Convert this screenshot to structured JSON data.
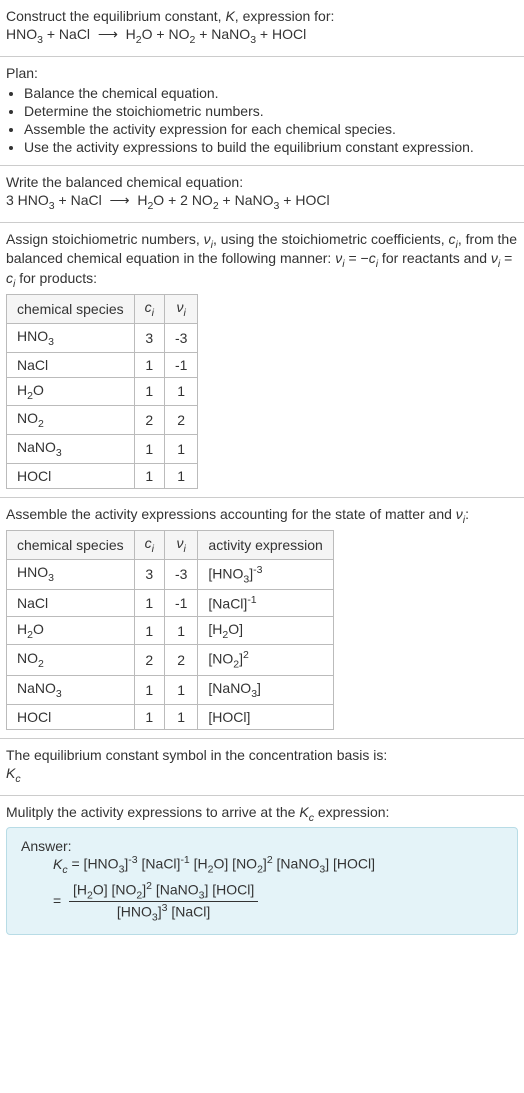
{
  "sec1": {
    "heading": "Construct the equilibrium constant, K, expression for:",
    "equation": "HNO₃ + NaCl  ⟶  H₂O + NO₂ + NaNO₃ + HOCl"
  },
  "sec2": {
    "heading": "Plan:",
    "bullets": [
      "Balance the chemical equation.",
      "Determine the stoichiometric numbers.",
      "Assemble the activity expression for each chemical species.",
      "Use the activity expressions to build the equilibrium constant expression."
    ]
  },
  "sec3": {
    "heading": "Write the balanced chemical equation:",
    "equation": "3 HNO₃ + NaCl  ⟶  H₂O + 2 NO₂ + NaNO₃ + HOCl"
  },
  "sec4": {
    "heading": "Assign stoichiometric numbers, νᵢ, using the stoichiometric coefficients, cᵢ, from the balanced chemical equation in the following manner: νᵢ = −cᵢ for reactants and νᵢ = cᵢ for products:",
    "headers": [
      "chemical species",
      "cᵢ",
      "νᵢ"
    ],
    "rows": [
      {
        "species": "HNO₃",
        "c": "3",
        "v": "-3"
      },
      {
        "species": "NaCl",
        "c": "1",
        "v": "-1"
      },
      {
        "species": "H₂O",
        "c": "1",
        "v": "1"
      },
      {
        "species": "NO₂",
        "c": "2",
        "v": "2"
      },
      {
        "species": "NaNO₃",
        "c": "1",
        "v": "1"
      },
      {
        "species": "HOCl",
        "c": "1",
        "v": "1"
      }
    ]
  },
  "sec5": {
    "heading": "Assemble the activity expressions accounting for the state of matter and νᵢ:",
    "headers": [
      "chemical species",
      "cᵢ",
      "νᵢ",
      "activity expression"
    ],
    "rows": [
      {
        "species": "HNO₃",
        "c": "3",
        "v": "-3",
        "act": "[HNO₃]⁻³"
      },
      {
        "species": "NaCl",
        "c": "1",
        "v": "-1",
        "act": "[NaCl]⁻¹"
      },
      {
        "species": "H₂O",
        "c": "1",
        "v": "1",
        "act": "[H₂O]"
      },
      {
        "species": "NO₂",
        "c": "2",
        "v": "2",
        "act": "[NO₂]²"
      },
      {
        "species": "NaNO₃",
        "c": "1",
        "v": "1",
        "act": "[NaNO₃]"
      },
      {
        "species": "HOCl",
        "c": "1",
        "v": "1",
        "act": "[HOCl]"
      }
    ]
  },
  "sec6": {
    "line1": "The equilibrium constant symbol in the concentration basis is:",
    "symbol": "K_c"
  },
  "sec7": {
    "heading": "Mulitply the activity expressions to arrive at the K_c expression:",
    "answer_label": "Answer:",
    "kc_eq_prefix": "K_c = ",
    "product": "[HNO₃]⁻³ [NaCl]⁻¹ [H₂O] [NO₂]² [NaNO₃] [HOCl]",
    "eq_sign": " = ",
    "frac_num": "[H₂O] [NO₂]² [NaNO₃] [HOCl]",
    "frac_den": "[HNO₃]³ [NaCl]"
  },
  "chart_data": {
    "type": "table",
    "tables": [
      {
        "title": "Stoichiometric numbers",
        "columns": [
          "chemical species",
          "c_i",
          "ν_i"
        ],
        "rows": [
          [
            "HNO3",
            3,
            -3
          ],
          [
            "NaCl",
            1,
            -1
          ],
          [
            "H2O",
            1,
            1
          ],
          [
            "NO2",
            2,
            2
          ],
          [
            "NaNO3",
            1,
            1
          ],
          [
            "HOCl",
            1,
            1
          ]
        ]
      },
      {
        "title": "Activity expressions",
        "columns": [
          "chemical species",
          "c_i",
          "ν_i",
          "activity expression"
        ],
        "rows": [
          [
            "HNO3",
            3,
            -3,
            "[HNO3]^-3"
          ],
          [
            "NaCl",
            1,
            -1,
            "[NaCl]^-1"
          ],
          [
            "H2O",
            1,
            1,
            "[H2O]"
          ],
          [
            "NO2",
            2,
            2,
            "[NO2]^2"
          ],
          [
            "NaNO3",
            1,
            1,
            "[NaNO3]"
          ],
          [
            "HOCl",
            1,
            1,
            "[HOCl]"
          ]
        ]
      }
    ]
  }
}
